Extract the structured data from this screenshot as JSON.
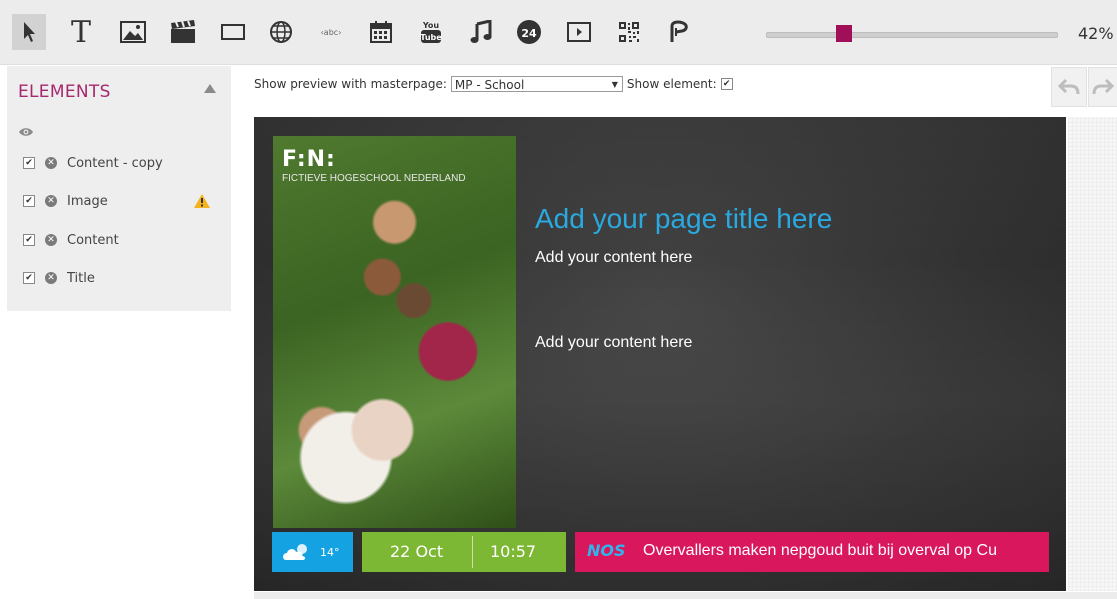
{
  "toolbar": {
    "tools": [
      {
        "name": "select-tool",
        "icon": "cursor-icon",
        "active": true
      },
      {
        "name": "text-tool",
        "icon": "text-icon",
        "label": "T"
      },
      {
        "name": "image-tool",
        "icon": "image-icon"
      },
      {
        "name": "video-tool",
        "icon": "clapperboard-icon"
      },
      {
        "name": "rectangle-tool",
        "icon": "rectangle-icon"
      },
      {
        "name": "web-tool",
        "icon": "globe-icon"
      },
      {
        "name": "ticker-tool",
        "icon": "ticker-icon",
        "label": "‹abc›"
      },
      {
        "name": "calendar-tool",
        "icon": "calendar-icon"
      },
      {
        "name": "youtube-tool",
        "icon": "youtube-icon",
        "label": "You Tube"
      },
      {
        "name": "audio-tool",
        "icon": "music-note-icon"
      },
      {
        "name": "news24-tool",
        "icon": "24-icon",
        "label": "24"
      },
      {
        "name": "media-tool",
        "icon": "play-icon"
      },
      {
        "name": "qr-tool",
        "icon": "qr-code-icon"
      },
      {
        "name": "signature-tool",
        "icon": "pen-icon"
      }
    ],
    "zoom": {
      "value_percent": 42,
      "label": "42%"
    }
  },
  "sidebar": {
    "title": "ELEMENTS",
    "items": [
      {
        "label": "Content - copy",
        "checked": true,
        "warning": false
      },
      {
        "label": "Image",
        "checked": true,
        "warning": true
      },
      {
        "label": "Content",
        "checked": true,
        "warning": false
      },
      {
        "label": "Title",
        "checked": true,
        "warning": false
      }
    ]
  },
  "preview": {
    "label": "Show preview with masterpage:",
    "masterpage": "MP - School",
    "show_element_label": "Show element:",
    "show_element_checked": true
  },
  "canvas": {
    "logo_mark": "F:N:",
    "logo_text": "FICTIEVE HOGESCHOOL NEDERLAND",
    "page_title": "Add your page title here",
    "content_1": "Add your content here",
    "content_2": "Add your content here",
    "weather_temp": "14°",
    "date": "22 Oct",
    "time": "10:57",
    "news_source": "NOS",
    "news_text": "Overvallers maken nepgoud buit bij overval op Cu"
  },
  "colors": {
    "accent": "#a10f58",
    "title_blue": "#2aa8e0",
    "weather_blue": "#15a2e2",
    "date_green": "#7db834",
    "news_pink": "#d8175d"
  }
}
